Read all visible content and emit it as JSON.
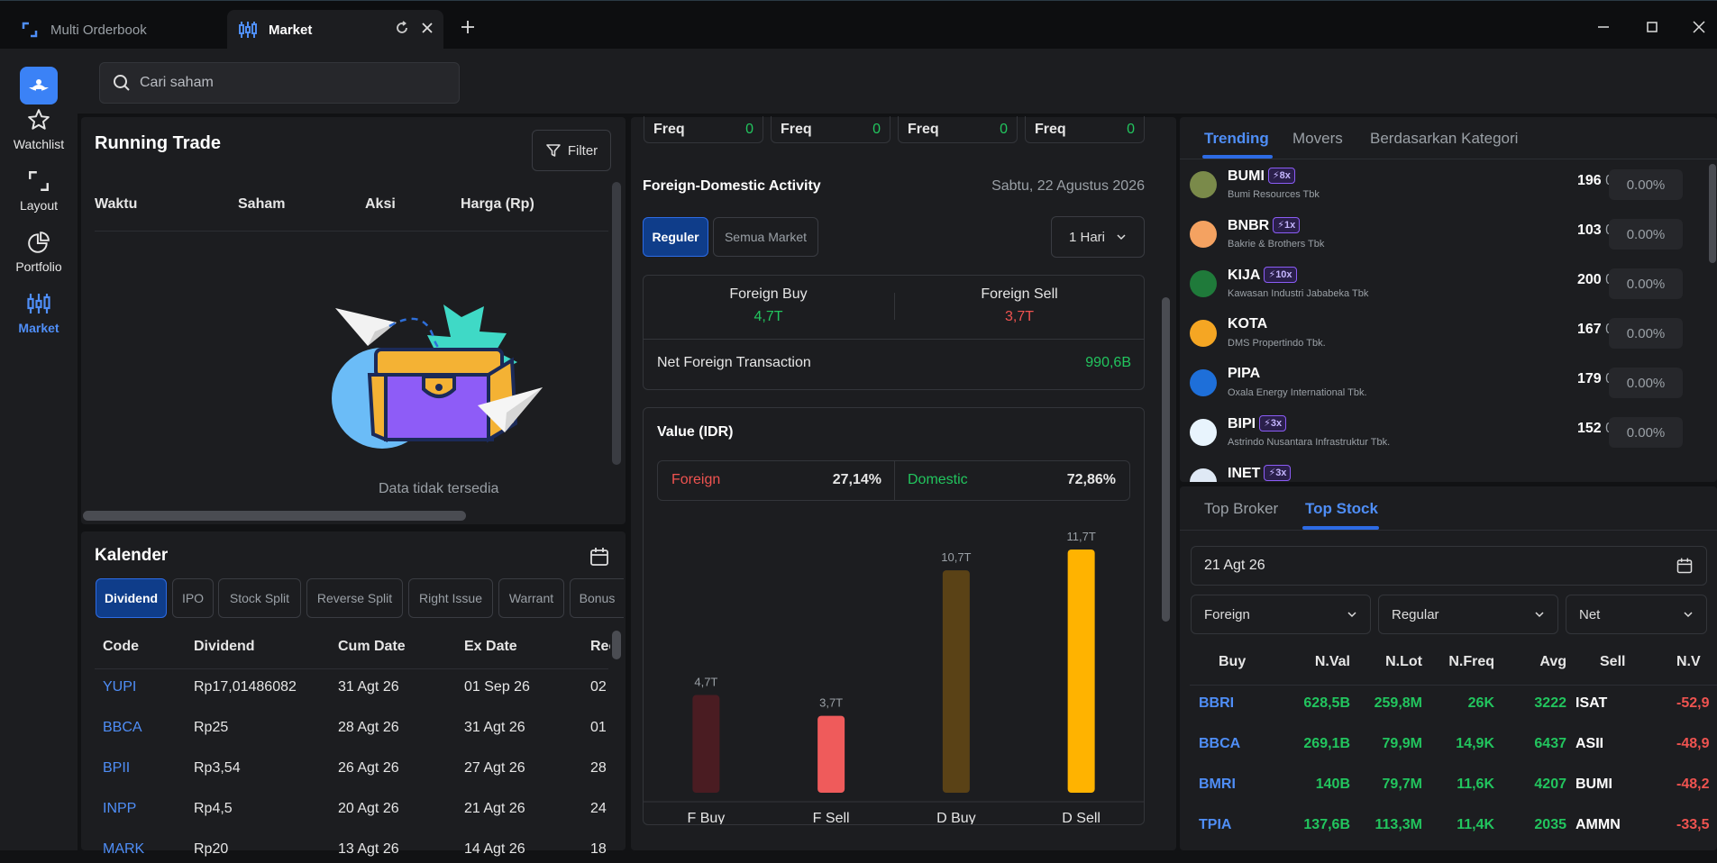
{
  "titlebar": {
    "tabs": [
      {
        "label": "Multi Orderbook"
      },
      {
        "label": "Market"
      }
    ]
  },
  "sidebar": {
    "items": [
      {
        "label": "Watchlist"
      },
      {
        "label": "Layout"
      },
      {
        "label": "Portfolio"
      },
      {
        "label": "Market"
      }
    ]
  },
  "search": {
    "placeholder": "Cari saham"
  },
  "running_trade": {
    "title": "Running Trade",
    "filter_label": "Filter",
    "columns": [
      "Waktu",
      "Saham",
      "Aksi",
      "Harga (Rp)"
    ],
    "empty_text": "Data tidak tersedia"
  },
  "calendar": {
    "title": "Kalender",
    "tabs": [
      "Dividend",
      "IPO",
      "Stock Split",
      "Reverse Split",
      "Right Issue",
      "Warrant",
      "Bonus"
    ],
    "columns": [
      "Code",
      "Dividend",
      "Cum Date",
      "Ex Date",
      "Rec"
    ],
    "rows": [
      {
        "code": "YUPI",
        "dividend": "Rp17,01486082",
        "cum": "31 Agt 26",
        "ex": "01 Sep 26",
        "rec": "02"
      },
      {
        "code": "BBCA",
        "dividend": "Rp25",
        "cum": "28 Agt 26",
        "ex": "31 Agt 26",
        "rec": "01"
      },
      {
        "code": "BPII",
        "dividend": "Rp3,54",
        "cum": "26 Agt 26",
        "ex": "27 Agt 26",
        "rec": "28"
      },
      {
        "code": "INPP",
        "dividend": "Rp4,5",
        "cum": "20 Agt 26",
        "ex": "21 Agt 26",
        "rec": "24"
      },
      {
        "code": "MARK",
        "dividend": "Rp20",
        "cum": "13 Agt 26",
        "ex": "14 Agt 26",
        "rec": "18"
      }
    ]
  },
  "freq": {
    "label": "Freq",
    "values": [
      "0",
      "0",
      "0",
      "0"
    ]
  },
  "foreign_domestic": {
    "title": "Foreign-Domestic Activity",
    "date": "Sabtu, 22 Agustus 2026",
    "tabs": [
      "Reguler",
      "Semua Market"
    ],
    "period": "1 Hari",
    "foreign_buy_label": "Foreign Buy",
    "foreign_buy_value": "4,7T",
    "foreign_sell_label": "Foreign Sell",
    "foreign_sell_value": "3,7T",
    "net_label": "Net Foreign Transaction",
    "net_value": "990,6B",
    "value_title": "Value (IDR)",
    "foreign_label": "Foreign",
    "foreign_pct": "27,14%",
    "domestic_label": "Domestic",
    "domestic_pct": "72,86%"
  },
  "chart_data": {
    "type": "bar",
    "categories": [
      "F Buy",
      "F Sell",
      "D Buy",
      "D Sell"
    ],
    "values": [
      4.7,
      3.7,
      10.7,
      11.7
    ],
    "data_labels": [
      "4,7T",
      "3,7T",
      "10,7T",
      "11,7T"
    ],
    "colors": [
      "#4a1c22",
      "#ef5b5b",
      "#5a4216",
      "#ffb300"
    ],
    "ylim": [
      0,
      11.7
    ],
    "grid": false,
    "legend": "none"
  },
  "trending": {
    "tabs": [
      "Trending",
      "Movers",
      "Berdasarkan Kategori"
    ],
    "rows": [
      {
        "ticker": "BUMI",
        "badge": "8x",
        "name": "Bumi Resources Tbk",
        "price": "196",
        "chg": "0",
        "pct": "0.00%",
        "color": "#7a8a4a"
      },
      {
        "ticker": "BNBR",
        "badge": "1x",
        "name": "Bakrie & Brothers Tbk",
        "price": "103",
        "chg": "0",
        "pct": "0.00%",
        "color": "#f4a261"
      },
      {
        "ticker": "KIJA",
        "badge": "10x",
        "name": "Kawasan Industri Jababeka Tbk",
        "price": "200",
        "chg": "0",
        "pct": "0.00%",
        "color": "#1f7a3a"
      },
      {
        "ticker": "KOTA",
        "badge": "",
        "name": "DMS Propertindo Tbk.",
        "price": "167",
        "chg": "0",
        "pct": "0.00%",
        "color": "#f5a623"
      },
      {
        "ticker": "PIPA",
        "badge": "",
        "name": "Oxala Energy International Tbk.",
        "price": "179",
        "chg": "0",
        "pct": "0.00%",
        "color": "#1e6fd9"
      },
      {
        "ticker": "BIPI",
        "badge": "3x",
        "name": "Astrindo Nusantara Infrastruktur Tbk.",
        "price": "152",
        "chg": "0",
        "pct": "0.00%",
        "color": "#e8f4fd"
      },
      {
        "ticker": "INET",
        "badge": "3x",
        "name": "",
        "price": "",
        "chg": "",
        "pct": "",
        "color": "#dfe9f5"
      }
    ]
  },
  "top_stock": {
    "tabs": [
      "Top Broker",
      "Top Stock"
    ],
    "date": "21 Agt 26",
    "filters": [
      "Foreign",
      "Regular",
      "Net"
    ],
    "columns": [
      "Buy",
      "N.Val",
      "N.Lot",
      "N.Freq",
      "Avg",
      "Sell",
      "N.V"
    ],
    "rows": [
      {
        "buy": "BBRI",
        "nval": "628,5B",
        "nlot": "259,8M",
        "nfreq": "26K",
        "avg": "3222",
        "sell": "ISAT",
        "nv": "-52,9"
      },
      {
        "buy": "BBCA",
        "nval": "269,1B",
        "nlot": "79,9M",
        "nfreq": "14,9K",
        "avg": "6437",
        "sell": "ASII",
        "nv": "-48,9"
      },
      {
        "buy": "BMRI",
        "nval": "140B",
        "nlot": "79,7M",
        "nfreq": "11,6K",
        "avg": "4207",
        "sell": "BUMI",
        "nv": "-48,2"
      },
      {
        "buy": "TPIA",
        "nval": "137,6B",
        "nlot": "113,3M",
        "nfreq": "11,4K",
        "avg": "2035",
        "sell": "AMMN",
        "nv": "-33,5"
      }
    ]
  }
}
